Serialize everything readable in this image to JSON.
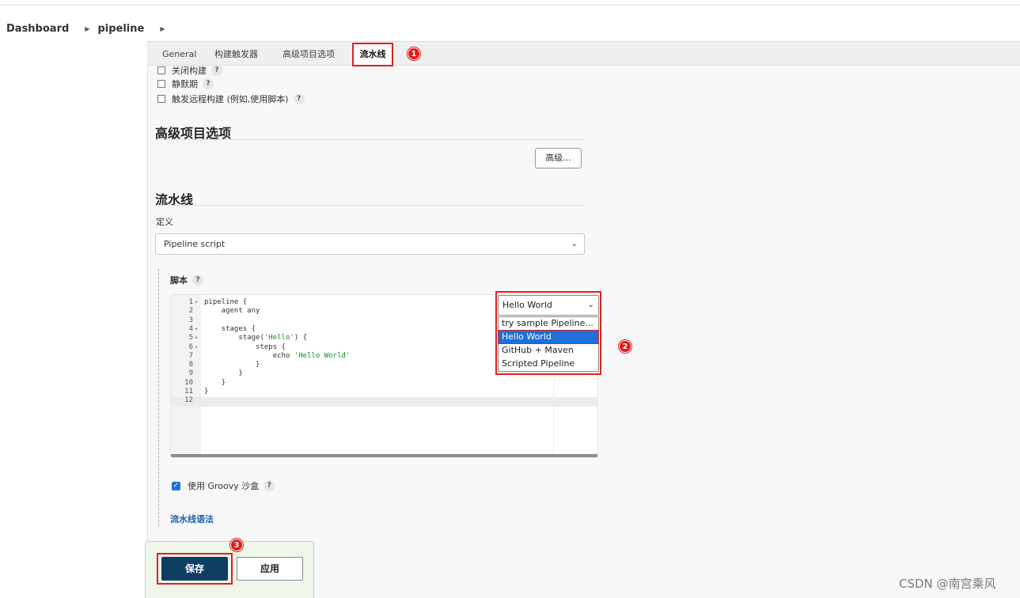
{
  "breadcrumb": {
    "items": [
      "Dashboard",
      "pipeline"
    ]
  },
  "tabs": [
    "General",
    "构建触发器",
    "高级项目选项",
    "流水线"
  ],
  "markers": [
    "1",
    "2",
    "3"
  ],
  "build_triggers": [
    "关闭构建",
    "静默期",
    "触发远程构建 (例如,使用脚本)"
  ],
  "help_glyph": "?",
  "advanced_section": {
    "title": "高级项目选项",
    "button_label": "高级..."
  },
  "pipeline_section": {
    "title": "流水线",
    "definition_label": "定义",
    "definition_value": "Pipeline script",
    "script_label": "脚本",
    "code_lines": [
      "pipeline {",
      "    agent any",
      "",
      "    stages {",
      "        stage('Hello') {",
      "            steps {",
      "                echo 'Hello World'",
      "            }",
      "        }",
      "    }",
      "}",
      ""
    ],
    "sample_select": {
      "value": "Hello World",
      "options": [
        "try sample Pipeline...",
        "Hello World",
        "GitHub + Maven",
        "Scripted Pipeline"
      ],
      "selected_index": 1
    },
    "sandbox_label": "使用 Groovy 沙盒",
    "syntax_link": "流水线语法"
  },
  "footer": {
    "save_label": "保存",
    "apply_label": "应用"
  },
  "watermark": "CSDN @南宫乘风",
  "colors": {
    "highlight": "#e02020",
    "save_bg": "#0f3e63",
    "link": "#1a5fb4",
    "selected_option": "#1e6fd9"
  }
}
